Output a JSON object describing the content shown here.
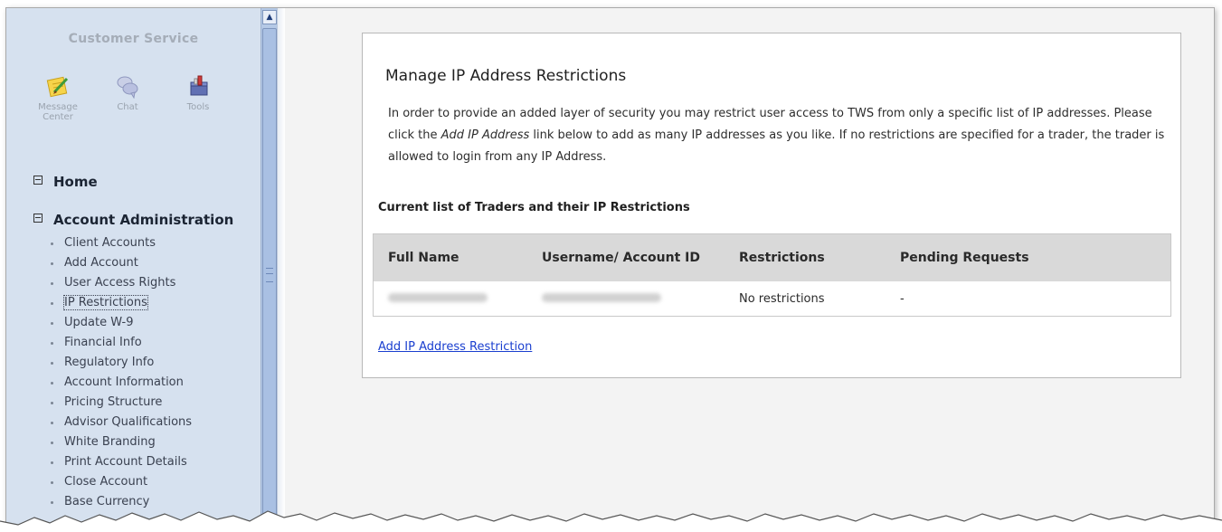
{
  "sidebar": {
    "title": "Customer Service",
    "tools": [
      {
        "label_line1": "Message",
        "label_line2": "Center",
        "icon": "notepad-icon"
      },
      {
        "label_line1": "Chat",
        "label_line2": "",
        "icon": "chat-bubbles-icon"
      },
      {
        "label_line1": "Tools",
        "label_line2": "",
        "icon": "toolbox-icon"
      }
    ],
    "home_label": "Home",
    "account_admin_label": "Account Administration",
    "items": [
      "Client Accounts",
      "Add Account",
      "User Access Rights",
      "IP Restrictions",
      "Update W-9",
      "Financial Info",
      "Regulatory Info",
      "Account Information",
      "Pricing Structure",
      "Advisor Qualifications",
      "White Branding",
      "Print Account Details",
      "Close Account",
      "Base Currency"
    ],
    "active_item": "IP Restrictions"
  },
  "main": {
    "title": "Manage IP Address Restrictions",
    "description_part1": "In order to provide an added layer of security you may restrict user access to TWS from only a specific list of IP addresses. Please click the ",
    "description_link_text": "Add IP Address",
    "description_part2": " link below to add as many IP addresses as you like. If no restrictions are specified for a trader, the trader is allowed to login from any IP Address.",
    "list_heading": "Current list of Traders and their IP Restrictions",
    "table": {
      "headers": [
        "Full Name",
        "Username/ Account ID",
        "Restrictions",
        "Pending Requests"
      ],
      "rows": [
        {
          "full_name": "",
          "username": "",
          "restrictions": "No restrictions",
          "pending": "-"
        }
      ]
    },
    "add_link": "Add IP Address Restriction"
  },
  "colors": {
    "sidebar_bg": "#d6e1ef",
    "link": "#1a3fcf",
    "table_header_bg": "#d9d9d9"
  }
}
